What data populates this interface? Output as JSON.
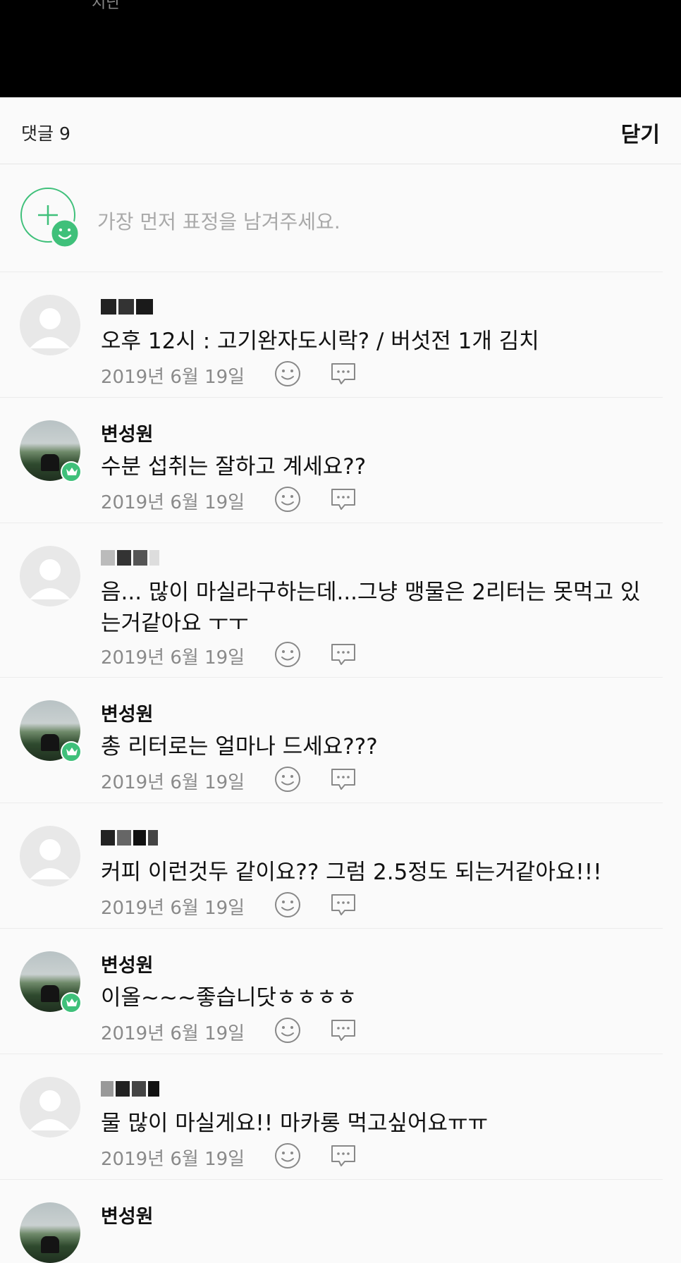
{
  "status_bar": {
    "partial_text": "지난"
  },
  "header": {
    "title": "댓글 9",
    "close_label": "닫기"
  },
  "reaction": {
    "prompt": "가장 먼저 표정을 남겨주세요."
  },
  "comments": [
    {
      "author": "",
      "text": "오후 12시 : 고기완자도시락? / 버섯전 1개 김치",
      "date": "2019년 6월 19일"
    },
    {
      "author": "변성원",
      "text": "수분 섭취는 잘하고 계세요??",
      "date": "2019년 6월 19일"
    },
    {
      "author": "",
      "text": "음... 많이 마실라구하는데...그냥  맹물은 2리터는 못먹고 있는거같아요 ㅜㅜ",
      "date": "2019년 6월 19일"
    },
    {
      "author": "변성원",
      "text": "총 리터로는 얼마나 드세요???",
      "date": "2019년 6월 19일"
    },
    {
      "author": "",
      "text": "커피 이런것두 같이요?? 그럼 2.5정도 되는거같아요!!!",
      "date": "2019년 6월 19일"
    },
    {
      "author": "변성원",
      "text": "이올~~~좋습니닷ㅎㅎㅎㅎ",
      "date": "2019년 6월 19일"
    },
    {
      "author": "",
      "text": "물 많이 마실게요!! 마카롱 먹고싶어요ㅠㅠ",
      "date": "2019년 6월 19일"
    },
    {
      "author": "변성원",
      "text": "",
      "date": ""
    }
  ],
  "icons": {
    "add_reaction": "add-reaction-icon",
    "reaction": "smiley-icon",
    "reply": "speech-bubble-icon",
    "host_badge": "crown-icon"
  },
  "colors": {
    "accent_green": "#3fc07a",
    "header_bg": "#000000",
    "date_gray": "#8a8a8a"
  }
}
